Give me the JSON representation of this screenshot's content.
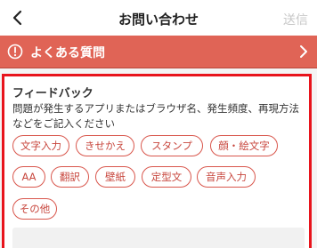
{
  "header": {
    "title": "お問い合わせ",
    "send_label": "送信"
  },
  "faq": {
    "label": "よくある質問"
  },
  "feedback": {
    "title": "フィードバック",
    "description": "問題が発生するアプリまたはブラウザ名、発生頻度、再現方法などをご記入ください",
    "tags": [
      "文字入力",
      "きせかえ",
      "スタンプ",
      "顔・絵文字",
      "AA",
      "翻訳",
      "壁紙",
      "定型文",
      "音声入力",
      "その他"
    ]
  },
  "colors": {
    "accent": "#e06456",
    "highlight_border": "#e8141c",
    "tag_text": "#c8473e",
    "send_disabled": "#c8c8c8"
  },
  "icons": {
    "back": "chevron-left-icon",
    "faq": "alert-circle-icon",
    "faq_arrow": "chevron-right-icon"
  }
}
